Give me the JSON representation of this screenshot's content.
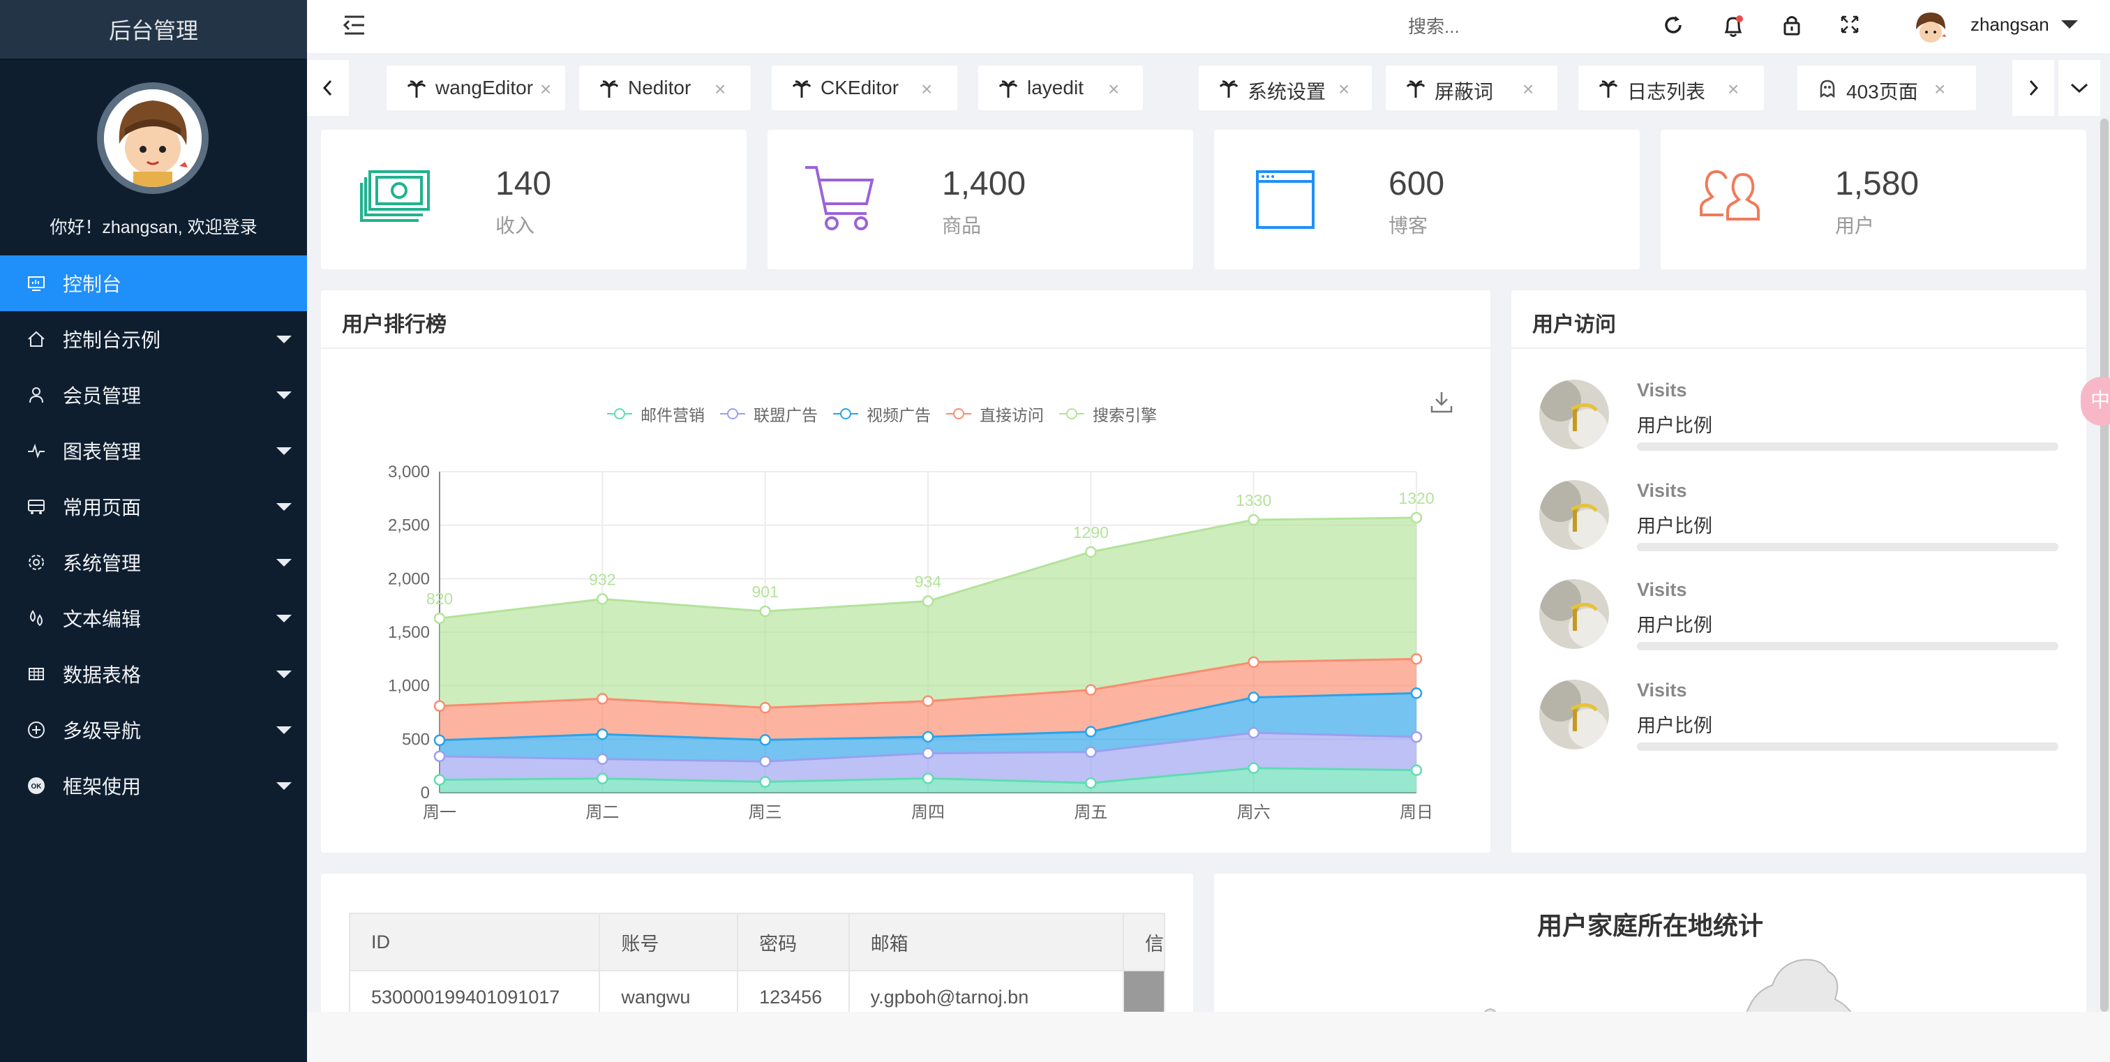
{
  "sidebar": {
    "logo": "后台管理",
    "welcome": "你好！zhangsan, 欢迎登录",
    "items": [
      {
        "label": "控制台",
        "icon": "dashboard-icon",
        "active": true
      },
      {
        "label": "控制台示例",
        "icon": "home-icon"
      },
      {
        "label": "会员管理",
        "icon": "user-icon"
      },
      {
        "label": "图表管理",
        "icon": "pulse-icon"
      },
      {
        "label": "常用页面",
        "icon": "bus-icon"
      },
      {
        "label": "系统管理",
        "icon": "gear-icon"
      },
      {
        "label": "文本编辑",
        "icon": "drops-icon"
      },
      {
        "label": "数据表格",
        "icon": "table-icon"
      },
      {
        "label": "多级导航",
        "icon": "plus-circle-icon"
      },
      {
        "label": "框架使用",
        "icon": "ok-icon"
      }
    ]
  },
  "header": {
    "search_placeholder": "搜索...",
    "username": "zhangsan"
  },
  "tabs": [
    {
      "label": "wangEditor"
    },
    {
      "label": "Neditor"
    },
    {
      "label": "CKEditor"
    },
    {
      "label": "layedit"
    },
    {
      "label": "系统设置"
    },
    {
      "label": "屏蔽词"
    },
    {
      "label": "日志列表"
    },
    {
      "label": "403页面"
    }
  ],
  "stats": [
    {
      "value": "140",
      "label": "收入",
      "color": "#20b28e"
    },
    {
      "value": "1,400",
      "label": "商品",
      "color": "#9a63d9"
    },
    {
      "value": "600",
      "label": "博客",
      "color": "#1f8ffa"
    },
    {
      "value": "1,580",
      "label": "用户",
      "color": "#f07a5a"
    }
  ],
  "ranking_card": {
    "title": "用户排行榜"
  },
  "chart_data": {
    "type": "area",
    "stacked": true,
    "categories": [
      "周一",
      "周二",
      "周三",
      "周四",
      "周五",
      "周六",
      "周日"
    ],
    "y_ticks": [
      "0",
      "500",
      "1,000",
      "1,500",
      "2,000",
      "2,500",
      "3,000"
    ],
    "ylim": [
      0,
      3000
    ],
    "legend_position": "top-center",
    "grid": true,
    "series": [
      {
        "name": "邮件营销",
        "color": "#5fdcb3",
        "values": [
          120,
          132,
          101,
          134,
          90,
          230,
          210
        ]
      },
      {
        "name": "联盟广告",
        "color": "#9aa0ef",
        "values": [
          220,
          182,
          191,
          234,
          290,
          330,
          310
        ]
      },
      {
        "name": "视频广告",
        "color": "#2aa3e9",
        "values": [
          150,
          232,
          201,
          154,
          190,
          330,
          410
        ]
      },
      {
        "name": "直接访问",
        "color": "#fb8c6e",
        "values": [
          320,
          332,
          301,
          334,
          390,
          330,
          320
        ]
      },
      {
        "name": "搜索引擎",
        "color": "#b3e39a",
        "values": [
          820,
          932,
          901,
          934,
          1290,
          1330,
          1320
        ]
      }
    ],
    "data_labels": [
      "820",
      "932",
      "901",
      "934",
      "1290",
      "1330",
      "1320"
    ]
  },
  "visits_card": {
    "title": "用户访问",
    "rows": [
      {
        "title": "Visits",
        "subtitle": "用户比例",
        "progress": 0
      },
      {
        "title": "Visits",
        "subtitle": "用户比例",
        "progress": 0
      },
      {
        "title": "Visits",
        "subtitle": "用户比例",
        "progress": 0
      },
      {
        "title": "Visits",
        "subtitle": "用户比例",
        "progress": 0
      }
    ]
  },
  "table": {
    "headers": [
      "ID",
      "账号",
      "密码",
      "邮箱",
      "信"
    ],
    "rows": [
      [
        "530000199401091017",
        "wangwu",
        "123456",
        "y.gpboh@tarnoj.bn",
        ""
      ]
    ]
  },
  "map_card": {
    "title": "用户家庭所在地统计"
  },
  "float_button": "中"
}
